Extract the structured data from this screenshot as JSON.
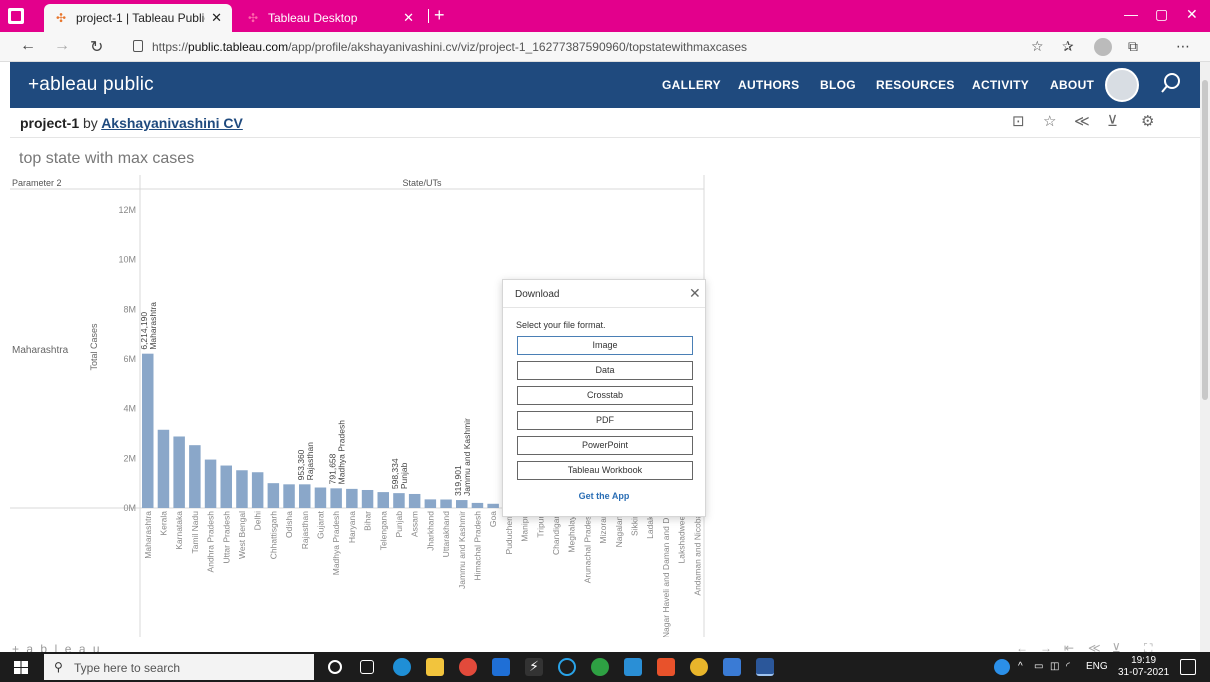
{
  "browser": {
    "tabs": [
      {
        "title": "project-1 | Tableau Public",
        "active": true
      },
      {
        "title": "Tableau Desktop",
        "active": false
      }
    ],
    "url_prefix": "https://",
    "url_host": "public.tableau.com",
    "url_path": "/app/profile/akshayanivashini.cv/viz/project-1_16277387590960/topstatewithmaxcases"
  },
  "header": {
    "logo": "+ableau public",
    "menu": [
      "GALLERY",
      "AUTHORS",
      "BLOG",
      "RESOURCES",
      "ACTIVITY",
      "ABOUT"
    ]
  },
  "viz": {
    "name": "project-1",
    "by": "by",
    "author": "Akshayanivashini CV",
    "sheet_title": "top state with max cases",
    "footer_logo": "+ a b | e a u"
  },
  "chart_data": {
    "type": "bar",
    "row_header": "Parameter 2",
    "row_value": "Maharashtra",
    "column_header": "State/UTs",
    "ylabel": "Total Cases",
    "ylim": [
      0,
      13000000
    ],
    "yticks": [
      "0M",
      "2M",
      "4M",
      "6M",
      "8M",
      "10M",
      "12M"
    ],
    "categories": [
      "Maharashtra",
      "Kerala",
      "Karnataka",
      "Tamil Nadu",
      "Andhra Pradesh",
      "Uttar Pradesh",
      "West Bengal",
      "Delhi",
      "Chhattisgarh",
      "Odisha",
      "Rajasthan",
      "Gujarat",
      "Madhya Pradesh",
      "Haryana",
      "Bihar",
      "Telengana",
      "Punjab",
      "Assam",
      "Jharkhand",
      "Uttarakhand",
      "Jammu and Kashmir",
      "Himachal Pradesh",
      "Goa",
      "Puducherry",
      "Manipur",
      "Tripura",
      "Chandigarh",
      "Meghalaya",
      "Arunachal Pradesh",
      "Mizoram",
      "Nagaland",
      "Sikkim",
      "Ladakh",
      "Dadra and Nagar Haveli and Daman and Diu",
      "Lakshadweep",
      "Andaman and Nicobar"
    ],
    "values": [
      6214190,
      3150000,
      2880000,
      2530000,
      1950000,
      1710000,
      1520000,
      1440000,
      1000000,
      953360,
      953360,
      825000,
      791658,
      770000,
      725000,
      640000,
      598334,
      565000,
      347000,
      342000,
      319901,
      205000,
      170000,
      120000,
      95000,
      70000,
      62000,
      58000,
      42000,
      35000,
      28000,
      27000,
      20000,
      10600,
      10000,
      7500
    ],
    "data_labels": [
      {
        "index": 0,
        "value": "6,214,190",
        "name": "Maharashtra"
      },
      {
        "index": 10,
        "value": "953,360",
        "name": "Rajasthan"
      },
      {
        "index": 12,
        "value": "791,658",
        "name": "Madhya Pradesh"
      },
      {
        "index": 16,
        "value": "598,334",
        "name": "Punjab"
      },
      {
        "index": 20,
        "value": "319,901",
        "name": "Jammu and Kashmir"
      }
    ],
    "bar_color": "#8aa7c9"
  },
  "dialog": {
    "title": "Download",
    "prompt": "Select your file format.",
    "options": [
      "Image",
      "Data",
      "Crosstab",
      "PDF",
      "PowerPoint",
      "Tableau Workbook"
    ],
    "link": "Get the App"
  },
  "taskbar": {
    "search_placeholder": "Type here to search",
    "lang": "ENG",
    "time": "19:19",
    "date": "31-07-2021"
  }
}
